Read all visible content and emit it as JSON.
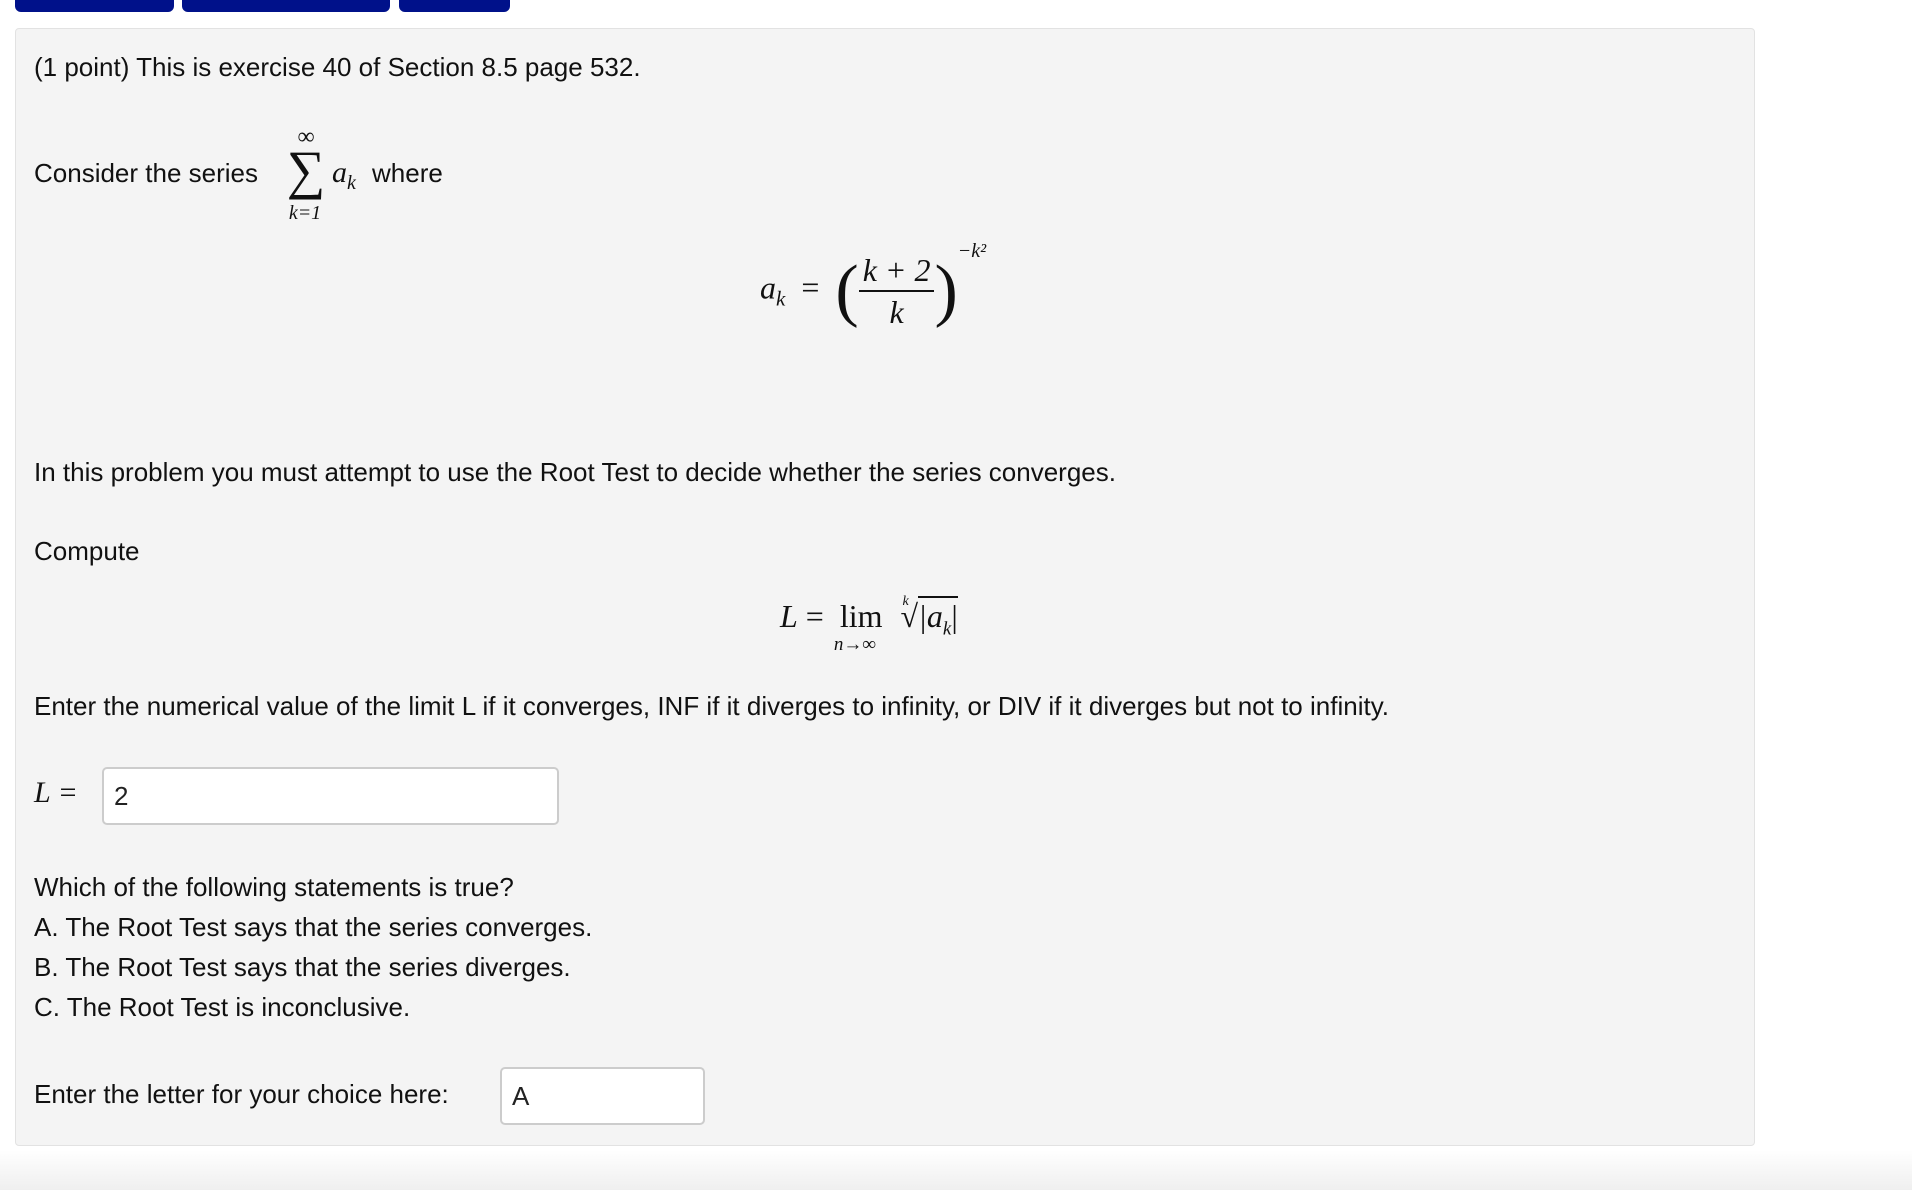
{
  "nav": {
    "buttons": [
      "",
      "",
      ""
    ],
    "accent": "#00118a"
  },
  "problem": {
    "header": "(1 point) This is exercise 40 of Section 8.5 page 532.",
    "consider_prefix": "Consider the series",
    "consider_suffix": "where",
    "sum_upper": "∞",
    "sum_lower": "k=1",
    "sum_term": "a",
    "sum_sub": "k",
    "formula": {
      "lhs": "a",
      "lhs_sub": "k",
      "eq": "=",
      "num": "k + 2",
      "den": "k",
      "exp": "−k²"
    },
    "instruction": "In this problem you must attempt to use the Root Test to decide whether the series converges.",
    "compute": "Compute",
    "limit": {
      "L": "L",
      "eq": "=",
      "lim": "lim",
      "under": "n→∞",
      "root_index": "k",
      "radicand": "|a",
      "radicand_sub": "k",
      "radicand_end": "|"
    },
    "enter_value": "Enter the numerical value of the limit L if it converges, INF if it diverges to infinity, or DIV if it diverges but not to infinity.",
    "answer_label": "L =",
    "answer_value": "2",
    "question": "Which of the following statements is true?",
    "options": [
      "A. The Root Test says that the series converges.",
      "B. The Root Test says that the series diverges.",
      "C. The Root Test is inconclusive."
    ],
    "choice_label": "Enter the letter for your choice here:",
    "choice_value": "A"
  }
}
